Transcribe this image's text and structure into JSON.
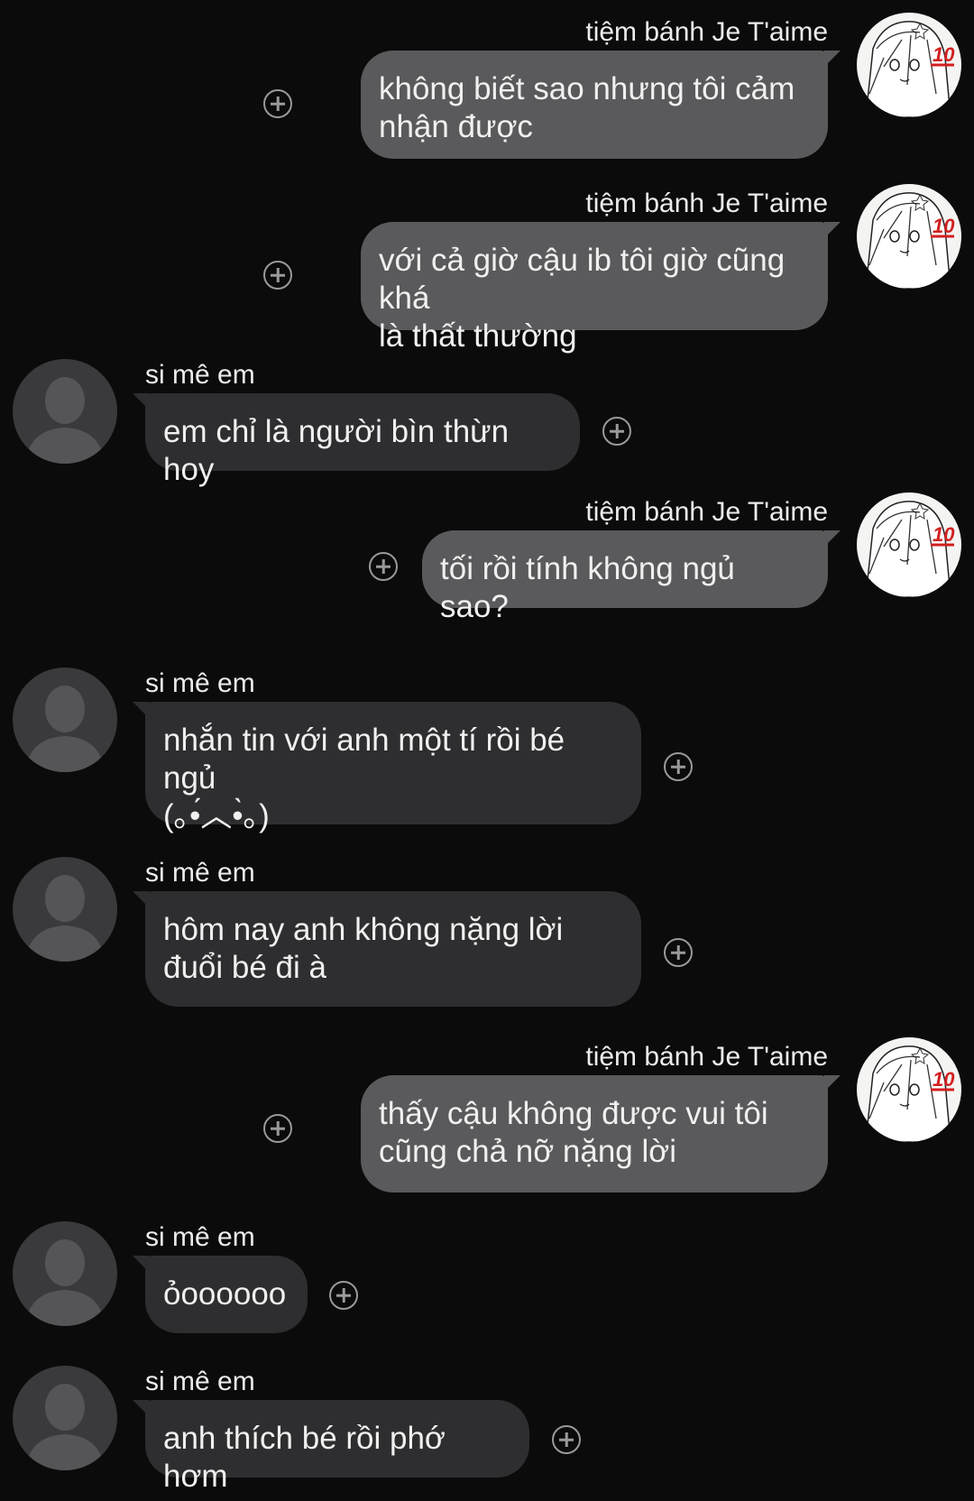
{
  "chat": {
    "messages": [
      {
        "side": "right",
        "sender": "tiệm bánh Je T'aime",
        "text": "không biết sao nhưng tôi cảm\nnhận được",
        "avatar_badge": "10"
      },
      {
        "side": "right",
        "sender": "tiệm bánh Je T'aime",
        "text": "với cả giờ cậu ib tôi giờ cũng khá\nlà thất thường",
        "avatar_badge": "10"
      },
      {
        "side": "left",
        "sender": "si mê em",
        "text": "em chỉ là người bìn thừn hoy"
      },
      {
        "side": "right",
        "sender": "tiệm bánh Je T'aime",
        "text": "tối rồi tính không ngủ sao?",
        "avatar_badge": "10"
      },
      {
        "side": "left",
        "sender": "si mê em",
        "text": "nhắn tin với anh một tí rồi bé ngủ\n(｡•́︿•̀｡)"
      },
      {
        "side": "left",
        "sender": "si mê em",
        "text": "hôm nay anh không nặng lời\nđuổi bé đi à"
      },
      {
        "side": "right",
        "sender": "tiệm bánh Je T'aime",
        "text": "thấy cậu không được vui tôi\ncũng chả nỡ nặng lời",
        "avatar_badge": "10"
      },
      {
        "side": "left",
        "sender": "si mê em",
        "text": "ỏoooooo"
      },
      {
        "side": "left",
        "sender": "si mê em",
        "text": "anh thích bé rồi phớ hơm"
      }
    ]
  },
  "icons": {
    "add": "plus-circle-icon",
    "default_avatar": "person-silhouette-icon",
    "anime_avatar": "anime-girl-avatar-icon"
  },
  "colors": {
    "background": "#0b0b0c",
    "bubble_outgoing": "#5a5a5c",
    "bubble_incoming": "#2e2e30",
    "text": "#f0f0f0",
    "badge_red": "#d21f1f"
  }
}
